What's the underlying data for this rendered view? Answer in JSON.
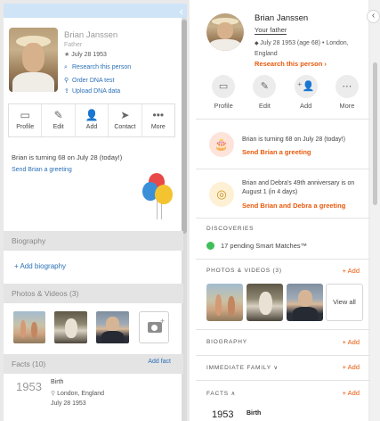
{
  "left_panel": {
    "name": "Brian Janssen",
    "relationship": "Father",
    "birth": "July 28 1953",
    "links": [
      {
        "icon": "search-icon",
        "label": "Research this person"
      },
      {
        "icon": "dna-icon",
        "label": "Order DNA test"
      },
      {
        "icon": "upload-icon",
        "label": "Upload DNA data"
      }
    ],
    "actions": [
      {
        "icon": "profile-icon",
        "label": "Profile"
      },
      {
        "icon": "edit-icon",
        "label": "Edit"
      },
      {
        "icon": "add-person-icon",
        "label": "Add"
      },
      {
        "icon": "send-icon",
        "label": "Contact"
      },
      {
        "icon": "more-icon",
        "label": "More"
      }
    ],
    "birthday_notice": "Brian is turning 68 on July 28 (today!)",
    "send_greeting": "Send Brian a greeting",
    "sections": {
      "biography": "Biography",
      "add_biography": "+ Add biography",
      "photos": "Photos & Videos (3)",
      "facts": "Facts (10)",
      "add_fact": "Add fact"
    },
    "fact": {
      "year": "1953",
      "label": "Birth",
      "place": "London, England",
      "date": "July 28 1953"
    }
  },
  "right_panel": {
    "name": "Brian Janssen",
    "relationship": "Your father",
    "birth": "July 28 1953 (age 68) • London, England",
    "research": "Research this person ›",
    "actions": [
      {
        "icon": "profile-icon",
        "label": "Profile"
      },
      {
        "icon": "edit-icon",
        "label": "Edit"
      },
      {
        "icon": "add-person-icon",
        "label": "Add"
      },
      {
        "icon": "more-icon",
        "label": "More"
      }
    ],
    "events": [
      {
        "icon": "cake-icon",
        "text": "Brian is turning 68 on July 28 (today!)",
        "link": "Send Brian a greeting"
      },
      {
        "icon": "rings-icon",
        "text": "Brian and Debra's 49th anniversary is on August 1 (in 4 days)",
        "link": "Send Brian and Debra a greeting"
      }
    ],
    "discoveries_label": "DISCOVERIES",
    "smart_matches": "17 pending Smart Matches™",
    "photos_label": "PHOTOS & VIDEOS (3)",
    "add_label": "+ Add",
    "view_all": "View all",
    "biography_label": "BIOGRAPHY",
    "family_label": "IMMEDIATE FAMILY ∨",
    "facts_label": "FACTS ∧",
    "fact": {
      "year": "1953",
      "label": "Birth"
    }
  },
  "colors": {
    "accent_orange": "#e8590c",
    "link_blue": "#2a6fb6",
    "match_green": "#3fbf59"
  }
}
